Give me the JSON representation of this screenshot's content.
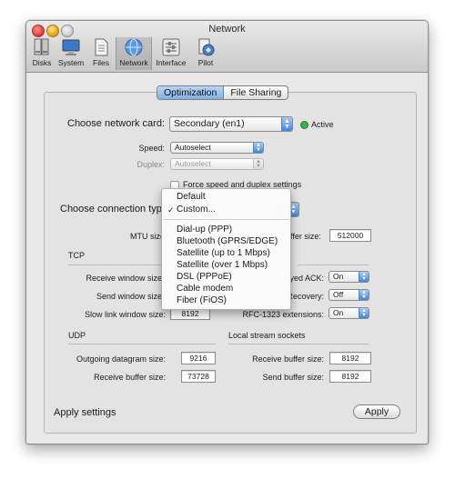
{
  "window": {
    "title": "Network"
  },
  "toolbar": {
    "items": [
      {
        "label": "Disks",
        "icon": "disks-icon"
      },
      {
        "label": "System",
        "icon": "monitor-icon"
      },
      {
        "label": "Files",
        "icon": "files-icon"
      },
      {
        "label": "Network",
        "icon": "network-globe-icon"
      },
      {
        "label": "Interface",
        "icon": "interface-sliders-icon"
      },
      {
        "label": "Pilot",
        "icon": "pilot-icon"
      }
    ],
    "selected": "Network"
  },
  "tabs": [
    {
      "label": "Optimization",
      "active": true
    },
    {
      "label": "File Sharing",
      "active": false
    }
  ],
  "network_card": {
    "label": "Choose network card:",
    "value": "Secondary (en1)",
    "status": "Active",
    "status_color": "#3fb04a"
  },
  "speed": {
    "label": "Speed:",
    "value": "Autoselect"
  },
  "duplex": {
    "label": "Duplex:",
    "value": "Autoselect"
  },
  "force_speed": {
    "label": "Force speed and duplex settings",
    "checked": false
  },
  "connection_type": {
    "label": "Choose connection type"
  },
  "mtu": {
    "label": "MTU size"
  },
  "buffer": {
    "label_partial": "ffer size:",
    "value": "512000"
  },
  "tcp": {
    "section": "TCP",
    "receive_window_label": "Receive window size",
    "send_window_label": "Send window size",
    "slow_link_label": "Slow link window size:",
    "slow_link_value": "8192",
    "delayed_ack_label": "layed ACK:",
    "delayed_ack_value": "On",
    "recovery_label": "Recovery:",
    "recovery_value": "Off",
    "rfc_label": "RFC-1323 extensions:",
    "rfc_value": "On"
  },
  "udp": {
    "section": "UDP",
    "outgoing_label": "Outgoing datagram size:",
    "outgoing_value": "9216",
    "receive_label": "Receive buffer size:",
    "receive_value": "73728"
  },
  "local_stream": {
    "section": "Local stream sockets",
    "receive_label": "Receive buffer size:",
    "receive_value": "8192",
    "send_label": "Send buffer size:",
    "send_value": "8192"
  },
  "footer": {
    "apply_settings_label": "Apply settings",
    "apply_button": "Apply"
  },
  "connection_menu": {
    "items": [
      {
        "label": "Default",
        "checked": false
      },
      {
        "label": "Custom...",
        "checked": true,
        "check_mark": "✓"
      },
      {
        "label": "Dial-up (PPP)"
      },
      {
        "label": "Bluetooth (GPRS/EDGE)"
      },
      {
        "label": "Satellite (up to 1 Mbps)"
      },
      {
        "label": "Satellite (over 1 Mbps)"
      },
      {
        "label": "DSL (PPPoE)"
      },
      {
        "label": "Cable modem"
      },
      {
        "label": "Fiber (FiOS)"
      }
    ]
  }
}
